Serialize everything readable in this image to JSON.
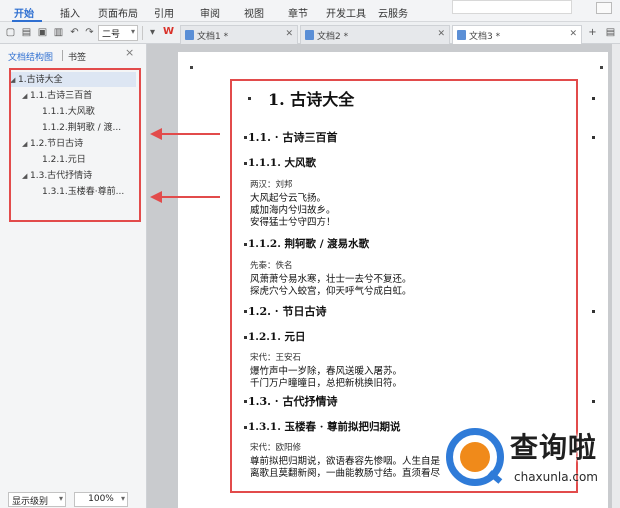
{
  "menu": {
    "items": [
      "开始",
      "插入",
      "页面布局",
      "引用",
      "审阅",
      "视图",
      "章节",
      "开发工具",
      "云服务"
    ],
    "active": "开始"
  },
  "toolbar": {
    "font_size": "二号"
  },
  "doc_tabs": [
    {
      "label": "文档1 *"
    },
    {
      "label": "文档2 *"
    },
    {
      "label": "文档3 *"
    }
  ],
  "nav": {
    "tab_outline": "文档结构图",
    "tab_bookmarks": "书签",
    "tree": [
      {
        "label": "1.古诗大全",
        "level": 0,
        "expandable": true
      },
      {
        "label": "1.1.古诗三百首",
        "level": 1,
        "expandable": true
      },
      {
        "label": "1.1.1.大风歌",
        "level": 2,
        "expandable": false
      },
      {
        "label": "1.1.2.荆轲歌 / 渡...",
        "level": 2,
        "expandable": false
      },
      {
        "label": "1.2.节日古诗",
        "level": 1,
        "expandable": true
      },
      {
        "label": "1.2.1.元日",
        "level": 2,
        "expandable": false
      },
      {
        "label": "1.3.古代抒情诗",
        "level": 1,
        "expandable": true
      },
      {
        "label": "1.3.1.玉楼春·尊前...",
        "level": 2,
        "expandable": false
      }
    ],
    "display_level": "显示级别",
    "zoom": "100%"
  },
  "document": {
    "h1": "1. 古诗大全",
    "s1": {
      "title": "1.1. · 古诗三百首"
    },
    "s1_1": {
      "title": "1.1.1. 大风歌",
      "author": "两汉：刘邦",
      "lines": [
        "大风起兮云飞扬。",
        "威加海内兮归故乡。",
        "安得猛士兮守四方！"
      ]
    },
    "s1_2": {
      "title": "1.1.2. 荆轲歌 / 渡易水歌",
      "author": "先秦：佚名",
      "lines": [
        "风萧萧兮易水寒，壮士一去兮不复还。",
        "探虎穴兮入蛟宫，仰天呼气兮成白虹。"
      ]
    },
    "s2": {
      "title": "1.2. · 节日古诗"
    },
    "s2_1": {
      "title": "1.2.1. 元日",
      "author": "宋代：王安石",
      "lines": [
        "爆竹声中一岁除，春风送暖入屠苏。",
        "千门万户曈曈日，总把新桃换旧符。"
      ]
    },
    "s3": {
      "title": "1.3. · 古代抒情诗"
    },
    "s3_1": {
      "title": "1.3.1. 玉楼春 · 尊前拟把归期说",
      "author": "宋代：欧阳修",
      "lines": [
        "尊前拟把归期说，欲语春容先惨咽。人生自是",
        "离歌且莫翻新阕，一曲能教肠寸结。直须看尽"
      ]
    }
  },
  "watermark": {
    "title": "查询啦",
    "subtitle": "chaxunla.com"
  },
  "colors": {
    "accent": "#2e6fd1",
    "annotation": "#e24b4b",
    "watermark_blue": "#2f7bd8",
    "watermark_orange": "#f08a1a"
  }
}
